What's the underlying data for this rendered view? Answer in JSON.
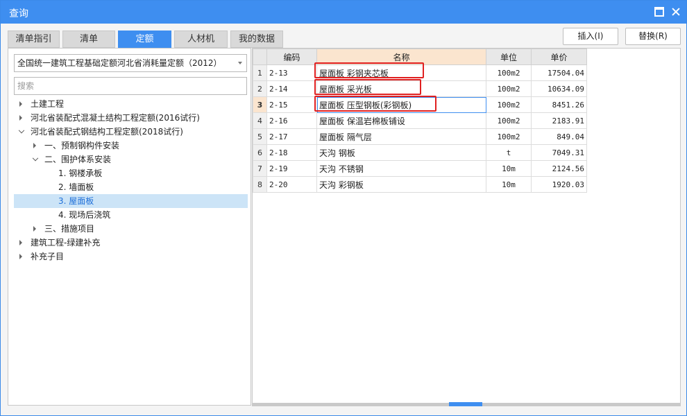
{
  "window": {
    "title": "查询"
  },
  "tabs": [
    {
      "label": "清单指引",
      "active": false
    },
    {
      "label": "清单",
      "active": false
    },
    {
      "label": "定额",
      "active": true
    },
    {
      "label": "人材机",
      "active": false
    },
    {
      "label": "我的数据",
      "active": false
    }
  ],
  "actions": {
    "insert_label": "插入(I)",
    "replace_label": "替换(R)"
  },
  "library": {
    "selected": "全国统一建筑工程基础定额河北省消耗量定额（2012）"
  },
  "search": {
    "placeholder": "搜索",
    "value": ""
  },
  "tree": [
    {
      "label": "土建工程",
      "level": 0,
      "state": "collapsed"
    },
    {
      "label": "河北省装配式混凝土结构工程定额(2016试行)",
      "level": 0,
      "state": "collapsed"
    },
    {
      "label": "河北省装配式钢结构工程定额(2018试行)",
      "level": 0,
      "state": "expanded"
    },
    {
      "label": "一、预制钢构件安装",
      "level": 1,
      "state": "collapsed"
    },
    {
      "label": "二、围护体系安装",
      "level": 1,
      "state": "expanded"
    },
    {
      "label": "1. 钢楼承板",
      "level": 2,
      "state": "leaf"
    },
    {
      "label": "2. 墙面板",
      "level": 2,
      "state": "leaf"
    },
    {
      "label": "3. 屋面板",
      "level": 2,
      "state": "leaf",
      "selected": true
    },
    {
      "label": "4. 现场后浇筑",
      "level": 2,
      "state": "leaf"
    },
    {
      "label": "三、措施项目",
      "level": 1,
      "state": "collapsed"
    },
    {
      "label": "建筑工程-绿建补充",
      "level": 0,
      "state": "collapsed"
    },
    {
      "label": "补充子目",
      "level": 0,
      "state": "collapsed"
    }
  ],
  "grid": {
    "headers": {
      "code": "编码",
      "name": "名称",
      "unit": "单位",
      "price": "单价"
    },
    "rows": [
      {
        "num": "1",
        "code": "2-13",
        "name": "屋面板 彩钢夹芯板",
        "unit": "100m2",
        "price": "17504.04"
      },
      {
        "num": "2",
        "code": "2-14",
        "name": "屋面板 采光板",
        "unit": "100m2",
        "price": "10634.09"
      },
      {
        "num": "3",
        "code": "2-15",
        "name": "屋面板 压型钢板(彩钢板)",
        "unit": "100m2",
        "price": "8451.26",
        "current": true
      },
      {
        "num": "4",
        "code": "2-16",
        "name": "屋面板 保温岩棉板铺设",
        "unit": "100m2",
        "price": "2183.91"
      },
      {
        "num": "5",
        "code": "2-17",
        "name": "屋面板 隔气层",
        "unit": "100m2",
        "price": "849.04"
      },
      {
        "num": "6",
        "code": "2-18",
        "name": "天沟 钢板",
        "unit": "t",
        "price": "7049.31"
      },
      {
        "num": "7",
        "code": "2-19",
        "name": "天沟 不锈钢",
        "unit": "10m",
        "price": "2124.56"
      },
      {
        "num": "8",
        "code": "2-20",
        "name": "天沟 彩钢板",
        "unit": "10m",
        "price": "1920.03"
      }
    ]
  },
  "colors": {
    "accent": "#3e8ef0",
    "highlight_box": "#e02020",
    "selected_row": "#cce4f7"
  }
}
